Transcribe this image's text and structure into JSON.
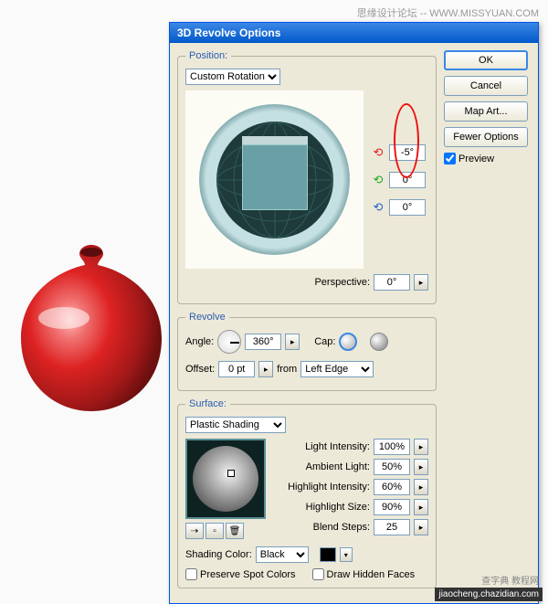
{
  "watermarks": {
    "top": "思缘设计论坛 -- WWW.MISSYUAN.COM",
    "br1": "查字典 教程网",
    "br2": "jiaocheng.chazidian.com"
  },
  "dialog": {
    "title": "3D Revolve Options",
    "buttons": {
      "ok": "OK",
      "cancel": "Cancel",
      "map_art": "Map Art...",
      "fewer_options": "Fewer Options"
    },
    "preview": {
      "label": "Preview",
      "checked": true
    }
  },
  "position": {
    "legend": "Position:",
    "rotation_select": "Custom Rotation",
    "axes": {
      "x": "-5°",
      "y": "0°",
      "z": "0°"
    },
    "perspective_label": "Perspective:",
    "perspective_value": "0°"
  },
  "revolve": {
    "legend": "Revolve",
    "angle_label": "Angle:",
    "angle_value": "360°",
    "cap_label": "Cap:",
    "offset_label": "Offset:",
    "offset_value": "0 pt",
    "from_label": "from",
    "from_select": "Left Edge"
  },
  "surface": {
    "legend": "Surface:",
    "shading_select": "Plastic Shading",
    "fields": {
      "light_intensity": {
        "label": "Light Intensity:",
        "value": "100%"
      },
      "ambient_light": {
        "label": "Ambient Light:",
        "value": "50%"
      },
      "highlight_intensity": {
        "label": "Highlight Intensity:",
        "value": "60%"
      },
      "highlight_size": {
        "label": "Highlight Size:",
        "value": "90%"
      },
      "blend_steps": {
        "label": "Blend Steps:",
        "value": "25"
      }
    },
    "shading_color_label": "Shading Color:",
    "shading_color_value": "Black",
    "preserve_spot": "Preserve Spot Colors",
    "draw_hidden": "Draw Hidden Faces"
  }
}
